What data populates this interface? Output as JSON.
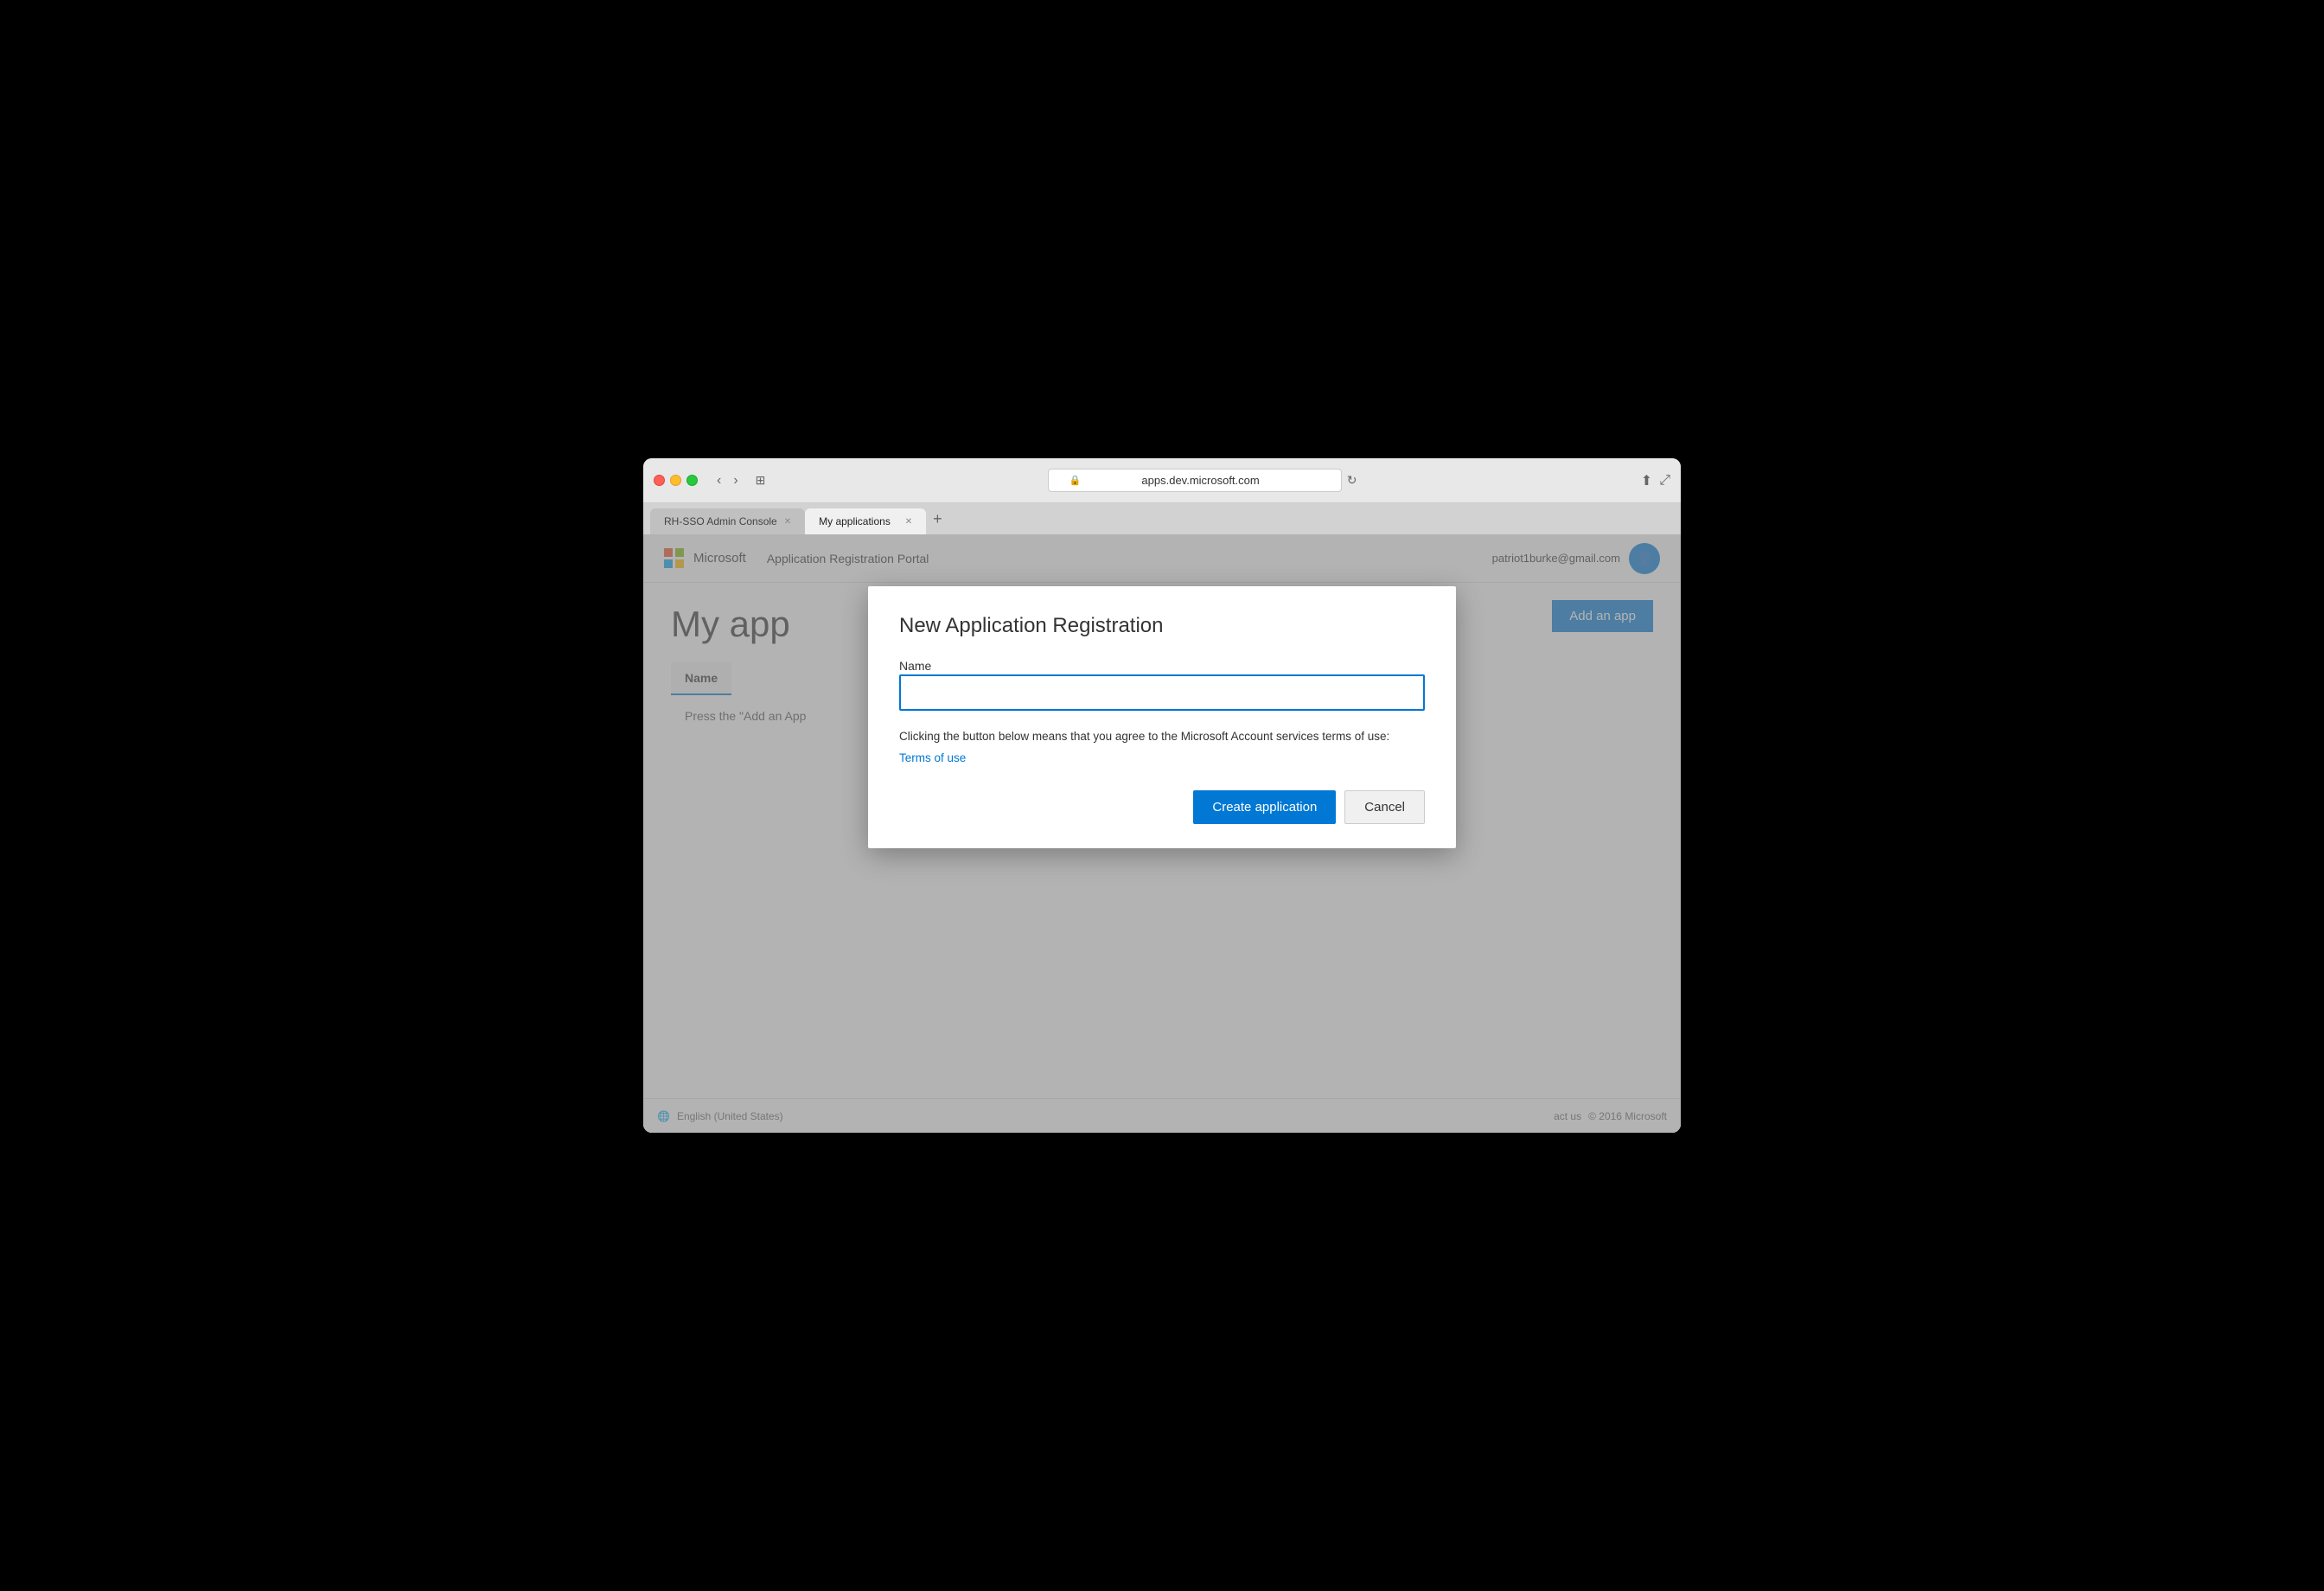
{
  "browser": {
    "url": "apps.dev.microsoft.com",
    "tabs": [
      {
        "label": "RH-SSO Admin Console",
        "active": false
      },
      {
        "label": "My applications",
        "active": true
      }
    ],
    "new_tab_label": "+"
  },
  "header": {
    "logo_text": "Microsoft",
    "portal_title": "Application Registration Portal",
    "user_email": "patriot1burke@gmail.com",
    "avatar_icon": "👤"
  },
  "page": {
    "title": "My app",
    "add_app_button": "Add an app",
    "table_header": "Name",
    "table_empty_text": "Press the \"Add an App",
    "footer_language": "English (United States)",
    "footer_contact": "act us",
    "footer_copyright": "© 2016 Microsoft"
  },
  "modal": {
    "title": "New Application Registration",
    "name_label": "Name",
    "name_placeholder": "",
    "tos_text": "Clicking the button below means that you agree to the Microsoft Account services terms of use:",
    "tos_link_label": "Terms of use",
    "tos_link_href": "#",
    "create_button": "Create application",
    "cancel_button": "Cancel"
  },
  "icons": {
    "lock": "🔒",
    "refresh": "↻",
    "back": "‹",
    "forward": "›",
    "share": "⬆",
    "fullscreen": "⤢",
    "globe": "🌐"
  }
}
